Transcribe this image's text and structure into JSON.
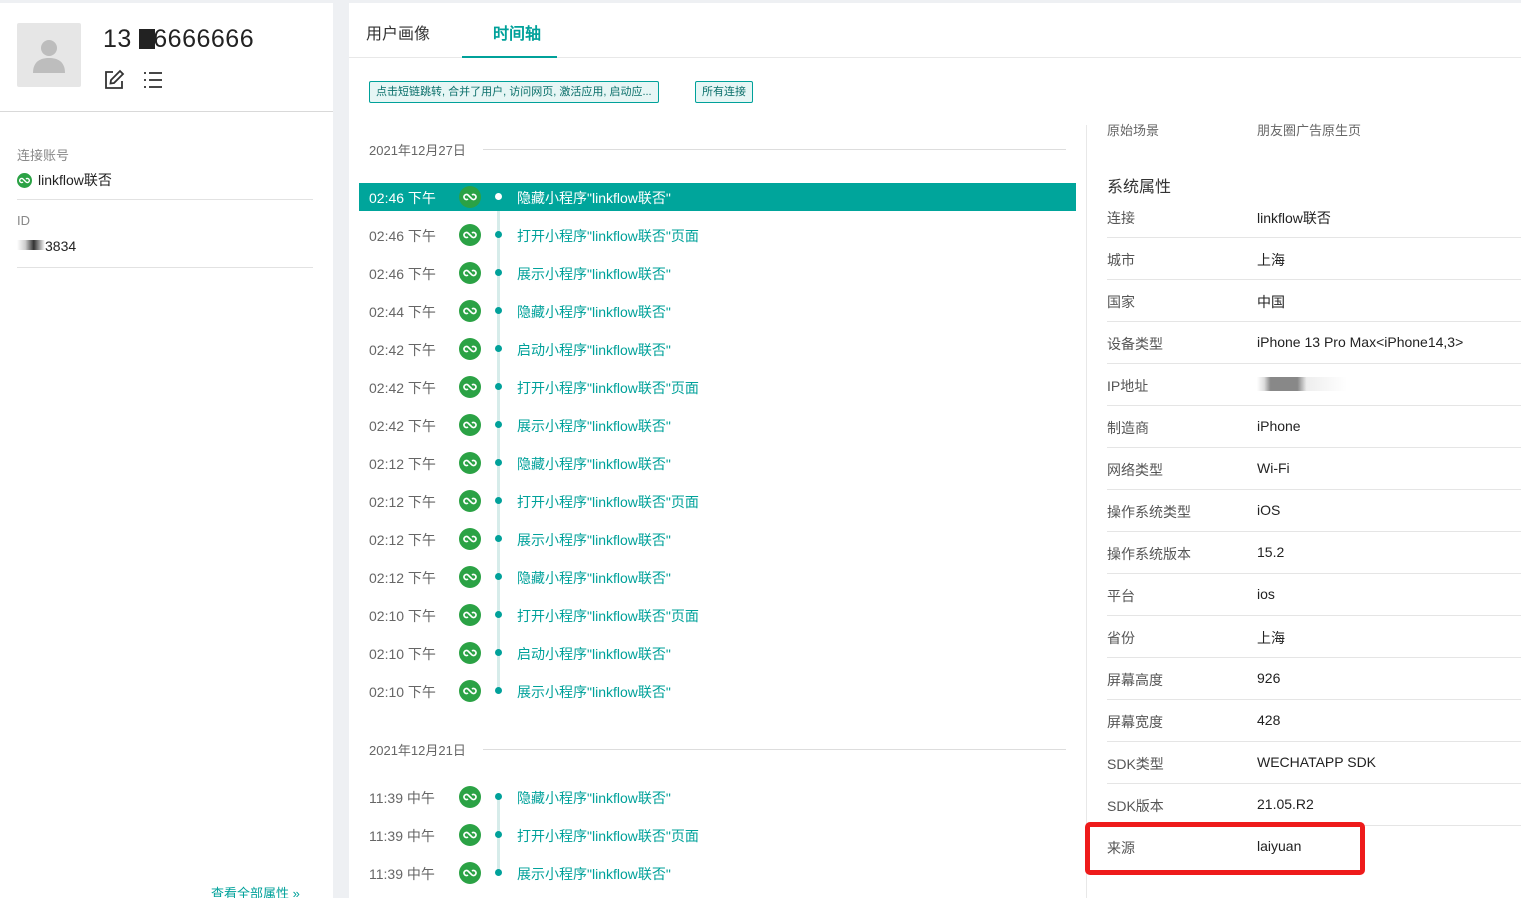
{
  "user": {
    "name_prefix": "13",
    "name_suffix": "6666666",
    "fields": [
      {
        "label": "连接账号",
        "value": "linkflow联否"
      },
      {
        "label": "ID",
        "value": "3834"
      }
    ],
    "see_all": "查看全部属性 »"
  },
  "tabs": [
    {
      "label": "用户画像",
      "active": false
    },
    {
      "label": "时间轴",
      "active": true
    }
  ],
  "filters": [
    "点击短链跳转, 合并了用户, 访问网页, 激活应用, 启动应...",
    "所有连接"
  ],
  "timeline": {
    "groups": [
      {
        "date": "2021年12月27日",
        "events": [
          {
            "time": "02:46 下午",
            "text": "隐藏小程序\"linkflow联否\"",
            "selected": true
          },
          {
            "time": "02:46 下午",
            "text": "打开小程序\"linkflow联否\"页面"
          },
          {
            "time": "02:46 下午",
            "text": "展示小程序\"linkflow联否\""
          },
          {
            "time": "02:44 下午",
            "text": "隐藏小程序\"linkflow联否\""
          },
          {
            "time": "02:42 下午",
            "text": "启动小程序\"linkflow联否\""
          },
          {
            "time": "02:42 下午",
            "text": "打开小程序\"linkflow联否\"页面"
          },
          {
            "time": "02:42 下午",
            "text": "展示小程序\"linkflow联否\""
          },
          {
            "time": "02:12 下午",
            "text": "隐藏小程序\"linkflow联否\""
          },
          {
            "time": "02:12 下午",
            "text": "打开小程序\"linkflow联否\"页面"
          },
          {
            "time": "02:12 下午",
            "text": "展示小程序\"linkflow联否\""
          },
          {
            "time": "02:12 下午",
            "text": "隐藏小程序\"linkflow联否\""
          },
          {
            "time": "02:10 下午",
            "text": "打开小程序\"linkflow联否\"页面"
          },
          {
            "time": "02:10 下午",
            "text": "启动小程序\"linkflow联否\""
          },
          {
            "time": "02:10 下午",
            "text": "展示小程序\"linkflow联否\""
          }
        ]
      },
      {
        "date": "2021年12月21日",
        "events": [
          {
            "time": "11:39 中午",
            "text": "隐藏小程序\"linkflow联否\""
          },
          {
            "time": "11:39 中午",
            "text": "打开小程序\"linkflow联否\"页面"
          },
          {
            "time": "11:39 中午",
            "text": "展示小程序\"linkflow联否\""
          }
        ]
      }
    ]
  },
  "properties": {
    "cut_off_row": {
      "key": "原始场景",
      "value": "朋友圈广告原生页"
    },
    "section_title": "系统属性",
    "rows": [
      {
        "key": "连接",
        "value": "linkflow联否"
      },
      {
        "key": "城市",
        "value": "上海"
      },
      {
        "key": "国家",
        "value": "中国"
      },
      {
        "key": "设备类型",
        "value": "iPhone 13 Pro Max<iPhone14,3>"
      },
      {
        "key": "IP地址",
        "value": ""
      },
      {
        "key": "制造商",
        "value": "iPhone"
      },
      {
        "key": "网络类型",
        "value": "Wi-Fi"
      },
      {
        "key": "操作系统类型",
        "value": "iOS"
      },
      {
        "key": "操作系统版本",
        "value": "15.2"
      },
      {
        "key": "平台",
        "value": "ios"
      },
      {
        "key": "省份",
        "value": "上海"
      },
      {
        "key": "屏幕高度",
        "value": "926"
      },
      {
        "key": "屏幕宽度",
        "value": "428"
      },
      {
        "key": "SDK类型",
        "value": "WECHATAPP SDK"
      },
      {
        "key": "SDK版本",
        "value": "21.05.R2"
      },
      {
        "key": "来源",
        "value": "laiyuan"
      }
    ]
  },
  "colors": {
    "accent": "#00a19a",
    "selected_row": "#00a59b",
    "wechat_icon": "#2ba245",
    "highlight_box": "#ee1b1b"
  }
}
